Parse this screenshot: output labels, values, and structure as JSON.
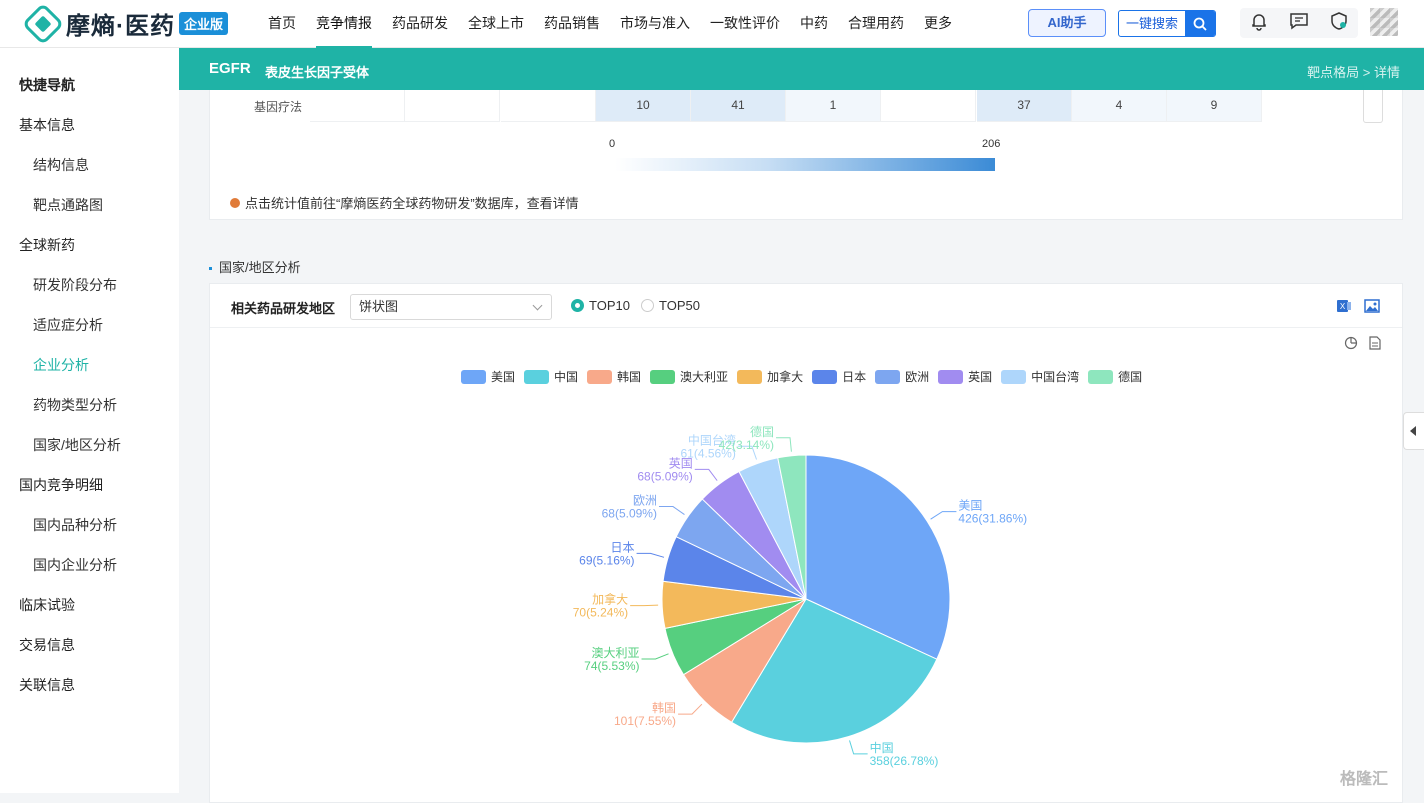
{
  "app": {
    "logo_text": "摩熵·医药",
    "logo_badge": "企业版"
  },
  "nav": [
    "首页",
    "竞争情报",
    "药品研发",
    "全球上市",
    "药品销售",
    "市场与准入",
    "一致性评价",
    "中药",
    "合理用药",
    "更多"
  ],
  "nav_active_index": 1,
  "ai_button": "AI助手",
  "search_button": "一键搜索",
  "sidebar": {
    "items": [
      {
        "label": "快捷导航",
        "level": 0,
        "title": true
      },
      {
        "label": "基本信息",
        "level": 0
      },
      {
        "label": "结构信息",
        "level": 1
      },
      {
        "label": "靶点通路图",
        "level": 1
      },
      {
        "label": "全球新药",
        "level": 0
      },
      {
        "label": "研发阶段分布",
        "level": 1
      },
      {
        "label": "适应症分析",
        "level": 1
      },
      {
        "label": "企业分析",
        "level": 1,
        "active": true
      },
      {
        "label": "药物类型分析",
        "level": 1
      },
      {
        "label": "国家/地区分析",
        "level": 1
      },
      {
        "label": "国内竞争明细",
        "level": 0
      },
      {
        "label": "国内品种分析",
        "level": 1
      },
      {
        "label": "国内企业分析",
        "level": 1
      },
      {
        "label": "临床试验",
        "level": 0
      },
      {
        "label": "交易信息",
        "level": 0
      },
      {
        "label": "关联信息",
        "level": 0
      }
    ]
  },
  "header": {
    "target": "EGFR",
    "target_name": "表皮生长因子受体",
    "breadcrumb": "靶点格局 > 详情"
  },
  "heatmap_row": {
    "label": "基因疗法",
    "cells": [
      "",
      "",
      "",
      "10",
      "41",
      "1",
      "",
      "37",
      "4",
      "9"
    ],
    "highlight": [
      false,
      false,
      false,
      true,
      true,
      false,
      false,
      true,
      false,
      false
    ]
  },
  "scale": {
    "min": "0",
    "max": "206"
  },
  "note": "点击统计值前往“摩熵医药全球药物研发”数据库，查看详情",
  "section": {
    "title": "国家/地区分析",
    "card_title": "相关药品研发地区",
    "chart_type_select": "饼状图",
    "radio": [
      {
        "label": "TOP10",
        "selected": true
      },
      {
        "label": "TOP50",
        "selected": false
      }
    ]
  },
  "chart_data": {
    "type": "pie",
    "categories": [
      "美国",
      "中国",
      "韩国",
      "澳大利亚",
      "加拿大",
      "日本",
      "欧洲",
      "英国",
      "中国台湾",
      "德国"
    ],
    "values": [
      426,
      358,
      101,
      74,
      70,
      69,
      68,
      68,
      61,
      42
    ],
    "percent_labels": [
      "426(31.86%)",
      "358(26.78%)",
      "101(7.55%)",
      "74(5.53%)",
      "70(5.24%)",
      "69(5.16%)",
      "68(5.09%)",
      "68(5.09%)",
      "61(4.56%)",
      "42(3.14%)"
    ],
    "colors": [
      "#6ea6f7",
      "#5ad0de",
      "#f8a98a",
      "#56cf7f",
      "#f3b95b",
      "#5b85ea",
      "#7da6f0",
      "#a18cf0",
      "#aed6fb",
      "#8ee6be"
    ],
    "legend_position": "top"
  },
  "watermark": "格隆汇"
}
